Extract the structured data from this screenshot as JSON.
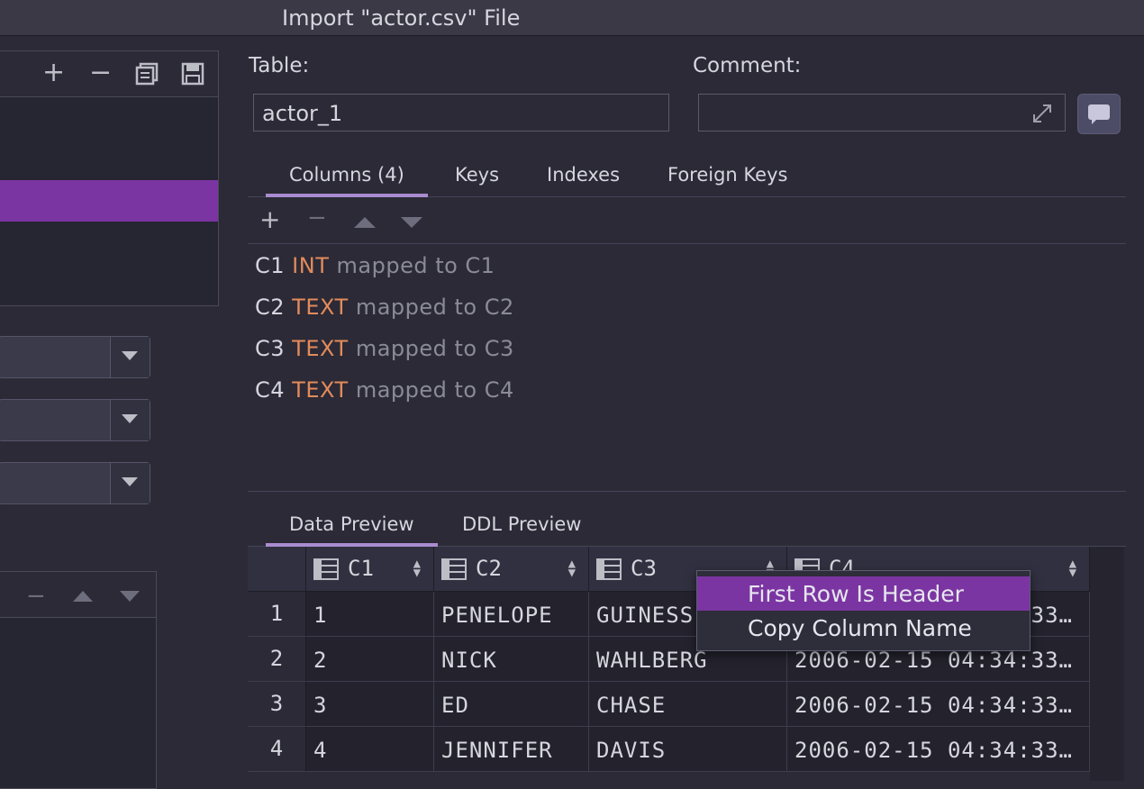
{
  "window": {
    "title": "Import \"actor.csv\" File"
  },
  "table_section": {
    "table_label": "Table:",
    "table_value": "actor_1",
    "comment_label": "Comment:",
    "comment_value": ""
  },
  "top_tabs": [
    {
      "label": "Columns (4)",
      "active": true
    },
    {
      "label": "Keys",
      "active": false
    },
    {
      "label": "Indexes",
      "active": false
    },
    {
      "label": "Foreign Keys",
      "active": false
    }
  ],
  "columns": [
    {
      "name": "C1",
      "type": "INT",
      "mapping": "mapped to C1"
    },
    {
      "name": "C2",
      "type": "TEXT",
      "mapping": "mapped to C2"
    },
    {
      "name": "C3",
      "type": "TEXT",
      "mapping": "mapped to C3"
    },
    {
      "name": "C4",
      "type": "TEXT",
      "mapping": "mapped to C4"
    }
  ],
  "bottom_tabs": [
    {
      "label": "Data Preview",
      "active": true
    },
    {
      "label": "DDL Preview",
      "active": false
    }
  ],
  "grid": {
    "headers": [
      "C1",
      "C2",
      "C3",
      "C4"
    ],
    "rows": [
      {
        "n": "1",
        "cells": [
          "1",
          "PENELOPE",
          "GUINESS",
          "2006-02-15 04:34:33…"
        ]
      },
      {
        "n": "2",
        "cells": [
          "2",
          "NICK",
          "WAHLBERG",
          "2006-02-15 04:34:33…"
        ]
      },
      {
        "n": "3",
        "cells": [
          "3",
          "ED",
          "CHASE",
          "2006-02-15 04:34:33…"
        ]
      },
      {
        "n": "4",
        "cells": [
          "4",
          "JENNIFER",
          "DAVIS",
          "2006-02-15 04:34:33…"
        ]
      }
    ]
  },
  "context_menu": {
    "items": [
      {
        "label": "First Row Is Header",
        "highlighted": true
      },
      {
        "label": "Copy Column Name",
        "highlighted": false
      }
    ]
  },
  "colors": {
    "accent": "#7b35a2",
    "type_color": "#e38b5c",
    "background": "#2b2a36"
  }
}
